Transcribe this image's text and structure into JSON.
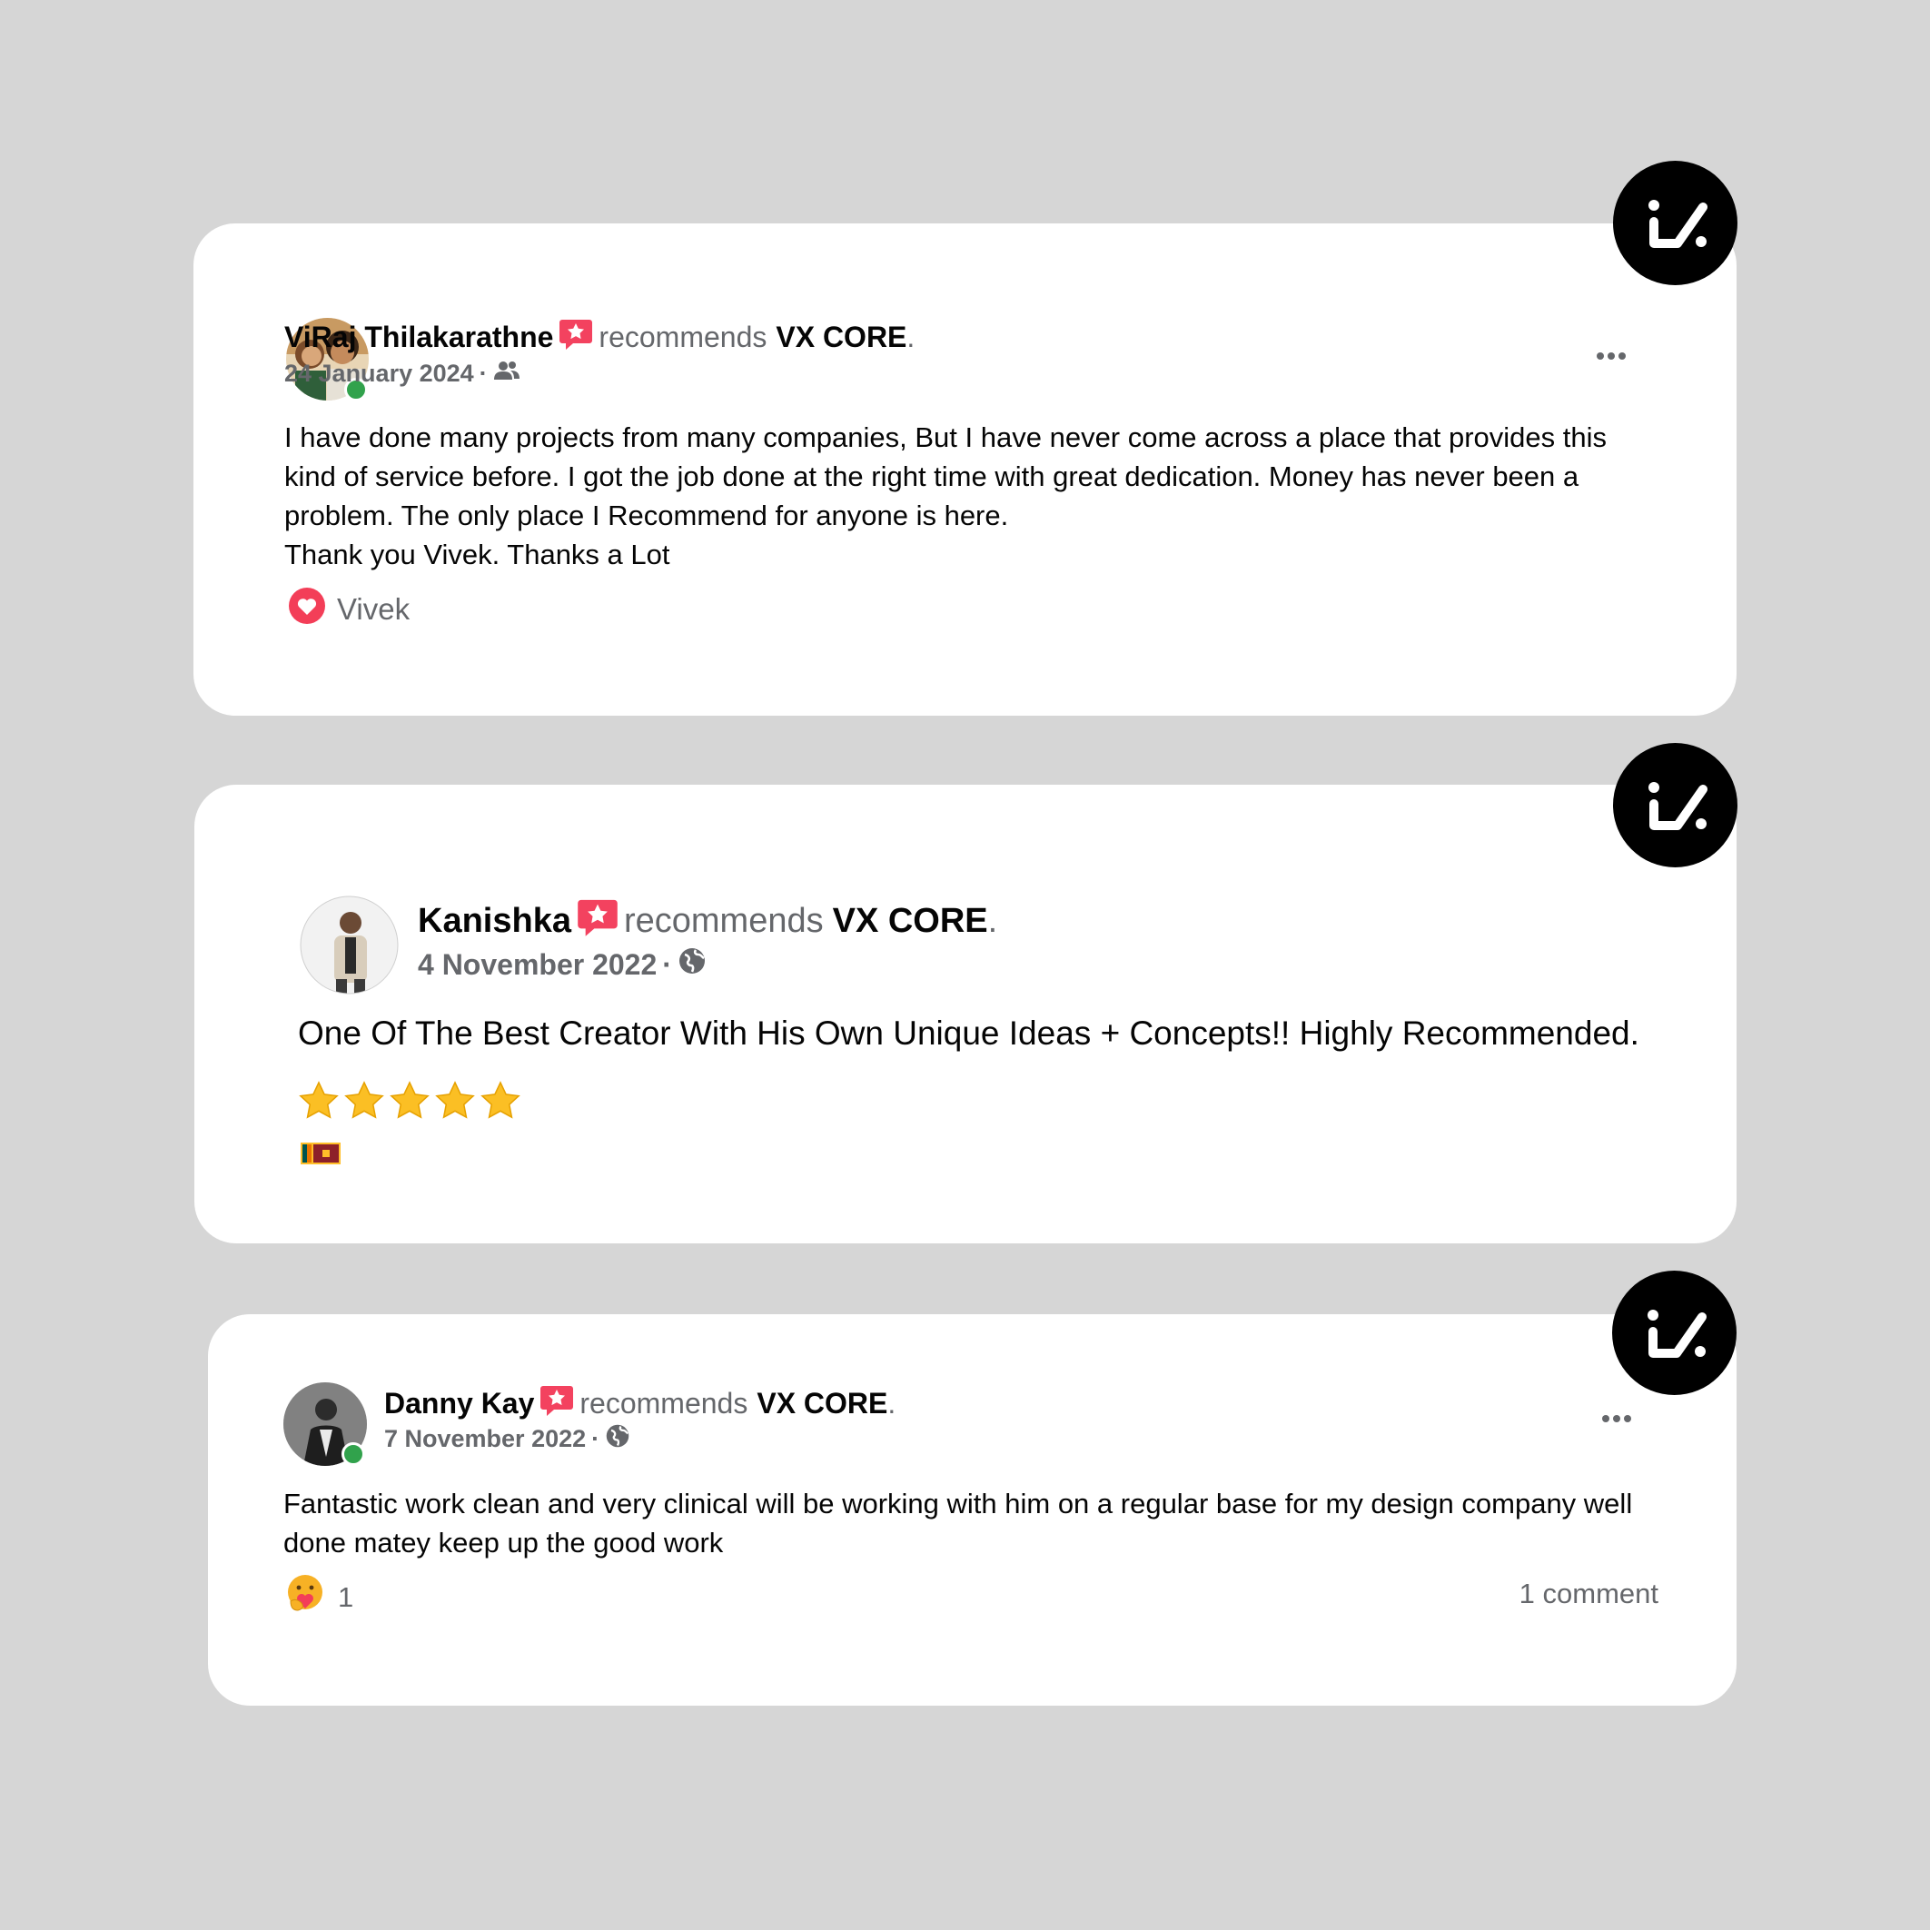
{
  "colors": {
    "background": "#d6d6d6",
    "card": "#ffffff",
    "badge": "#000000",
    "recommend_icon": "#f3425f",
    "online": "#31a24c",
    "secondary_text": "#65676b"
  },
  "reviews": [
    {
      "author": "ViRaj Thilakarathne",
      "recommends_label": "recommends",
      "page_name": "VX CORE",
      "period": ".",
      "date": "24 January 2024",
      "privacy_icon": "friends-icon",
      "body": "I have done many projects from many companies, But I have never come across a place that provides this kind of service before. I got the job done at the right time with great dedication. Money has never been a problem. The only place I Recommend for anyone is here.\nThank you Vivek. Thanks a Lot",
      "reaction_icon": "love-reaction-icon",
      "reaction_by": "Vivek",
      "online": true
    },
    {
      "author": "Kanishka",
      "recommends_label": "recommends",
      "page_name": "VX CORE",
      "period": ".",
      "date": "4 November 2022",
      "privacy_icon": "globe-icon",
      "body": "One Of The Best Creator With His Own Unique Ideas + Concepts!! Highly Recommended.",
      "stars": 5,
      "flag_icon": "sri-lanka-flag-icon"
    },
    {
      "author": "Danny Kay",
      "recommends_label": "recommends",
      "page_name": "VX CORE",
      "period": ".",
      "date": "7 November 2022",
      "privacy_icon": "globe-icon",
      "body": "Fantastic work clean and very clinical will be working with him on a regular base for my design company well done matey keep up the good work",
      "reaction_icon": "care-reaction-icon",
      "reaction_count": "1",
      "comments": "1 comment",
      "online": true
    }
  ]
}
